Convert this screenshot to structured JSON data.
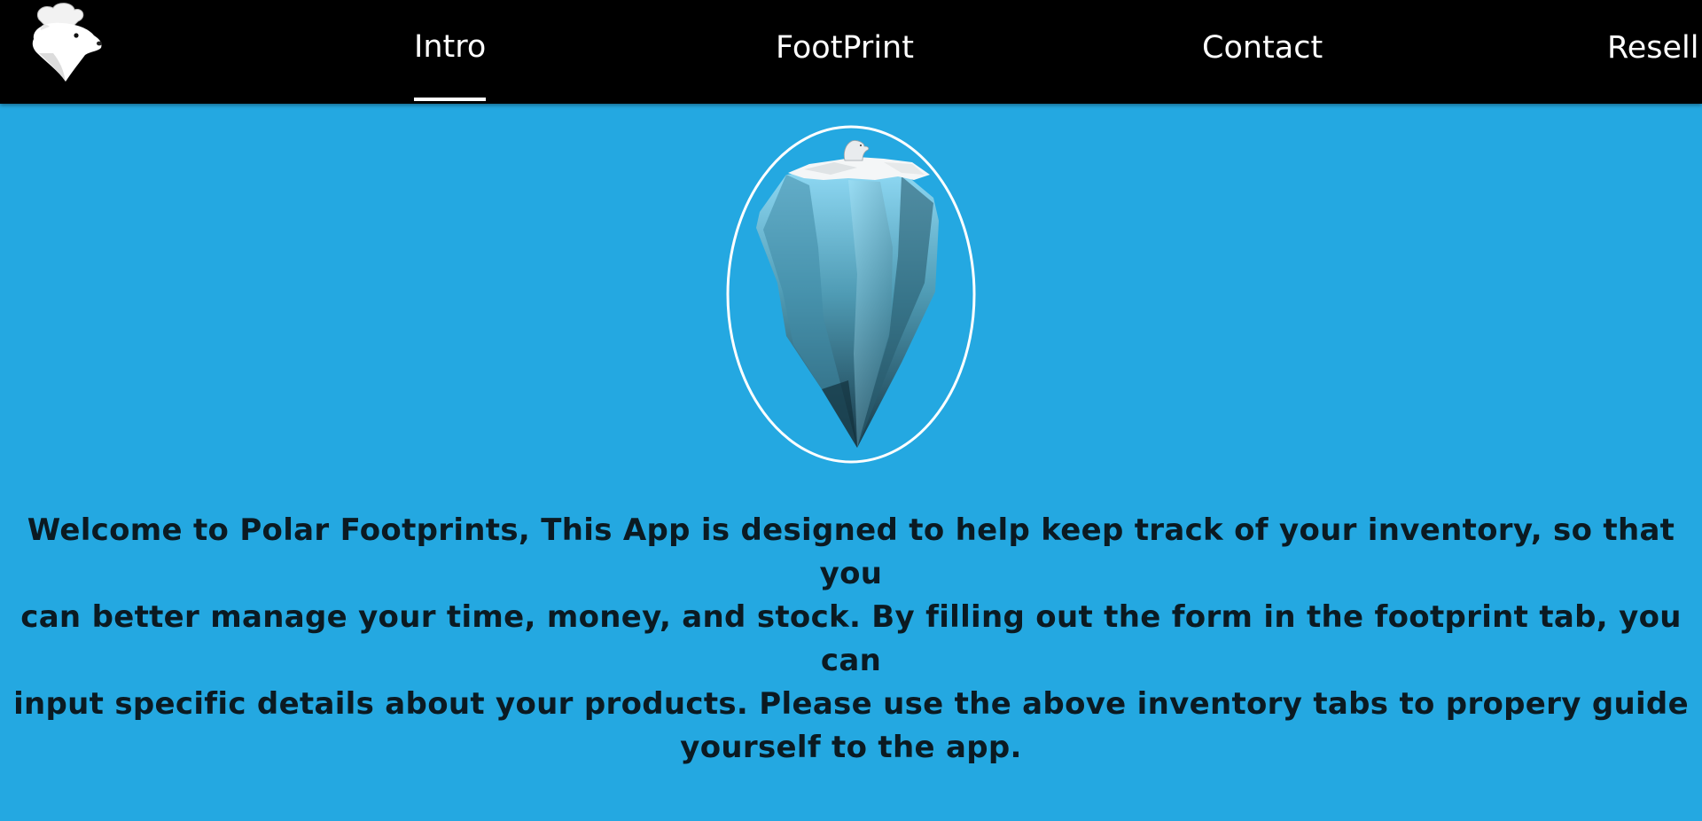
{
  "nav": {
    "logo_icon": "polar-bear-chef-icon",
    "tabs": [
      {
        "label": "Intro",
        "active": true
      },
      {
        "label": "FootPrint",
        "active": false
      },
      {
        "label": "Contact",
        "active": false
      },
      {
        "label": "Resell",
        "active": false
      }
    ]
  },
  "hero": {
    "image_icon": "iceberg-with-polar-bear-icon"
  },
  "welcome": {
    "lines": [
      "Welcome to Polar Footprints, This App is designed to help keep track of your inventory, so that you",
      "can better manage your time, money, and stock. By filling out the form in the footprint tab, you can",
      "input specific details about your products. Please use the above inventory tabs to propery guide",
      "yourself to the app."
    ]
  },
  "colors": {
    "background": "#24a8e1",
    "navbar": "#000000",
    "text": "#0b1a22",
    "tab_text": "#ffffff"
  }
}
